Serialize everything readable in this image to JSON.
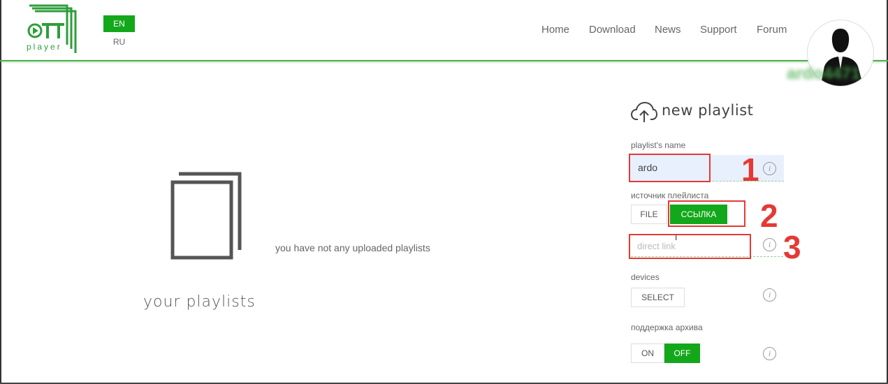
{
  "header": {
    "logo_text": "player",
    "languages": [
      {
        "code": "EN",
        "active": true
      },
      {
        "code": "RU",
        "active": false
      }
    ],
    "nav": {
      "home": "Home",
      "download": "Download",
      "news": "News",
      "support": "Support",
      "forum": "Forum"
    },
    "username": "ardo4471"
  },
  "main": {
    "empty_message": "you have not any uploaded playlists",
    "section_title": "your playlists"
  },
  "new_playlist": {
    "title": "new playlist",
    "name_label": "playlist's name",
    "name_value": "ardo",
    "source_label": "источник плейлиста",
    "source_options": {
      "file": "FILE",
      "link": "ССЫЛКА"
    },
    "source_selected": "ССЫЛКА",
    "link_placeholder": "direct link",
    "devices_label": "devices",
    "devices_button": "SELECT",
    "archive_label": "поддержка архива",
    "archive_on": "ON",
    "archive_off": "OFF",
    "archive_selected": "OFF",
    "info_symbol": "i"
  },
  "annotations": {
    "step1": "1",
    "step2": "2",
    "step3": "3"
  },
  "colors": {
    "accent_green": "#13a81b",
    "header_line": "#4caf50",
    "annotation_red": "#e53935"
  },
  "icons": {
    "logo": "ott-player-logo",
    "avatar": "user-avatar",
    "upload": "cloud-upload-icon",
    "empty": "documents-icon",
    "info": "info-icon"
  }
}
